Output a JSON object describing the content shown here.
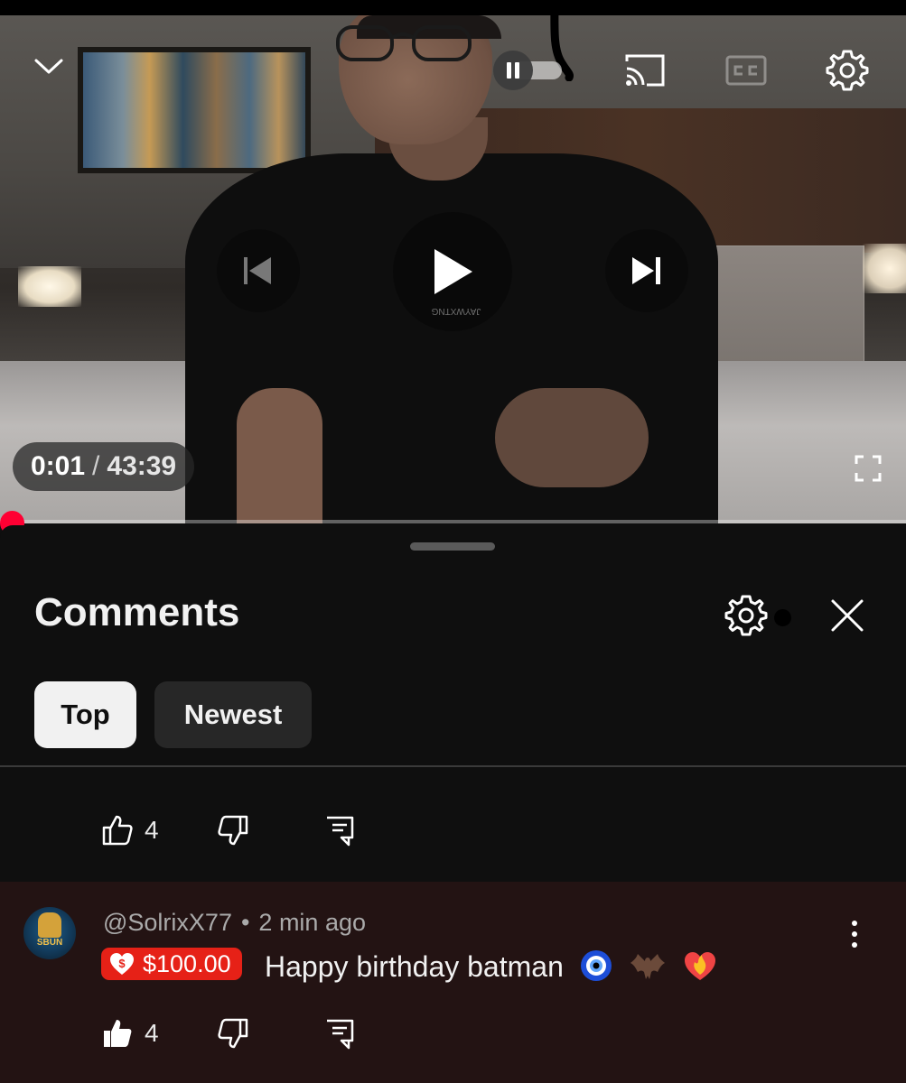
{
  "player": {
    "time_current": "0:01",
    "time_separator": "/",
    "time_duration": "43:39",
    "progress_fraction": 0.0004,
    "shirt_print": "JAYWXTNG",
    "controls": {
      "minimize_icon": "chevron-down-icon",
      "autoplay_icon": "pause-icon",
      "cast_icon": "cast-icon",
      "captions_icon": "cc-icon",
      "settings_icon": "gear-icon",
      "previous_icon": "skip-previous-icon",
      "play_icon": "play-icon",
      "next_icon": "skip-next-icon",
      "fullscreen_icon": "fullscreen-icon"
    },
    "accent_color": "#ff0033"
  },
  "comments": {
    "title": "Comments",
    "chips": [
      {
        "label": "Top",
        "selected": true
      },
      {
        "label": "Newest",
        "selected": false
      }
    ],
    "previous_comment": {
      "likes": "4"
    },
    "items": [
      {
        "handle": "@SolrixX77",
        "separator": "•",
        "time": "2 min ago",
        "super_thanks_amount": "$100.00",
        "text": "Happy birthday batman",
        "emojis": [
          "nazar-amulet",
          "bat",
          "heart-on-fire"
        ],
        "likes": "4",
        "liked": true,
        "avatar_text": "SBUN"
      }
    ]
  }
}
